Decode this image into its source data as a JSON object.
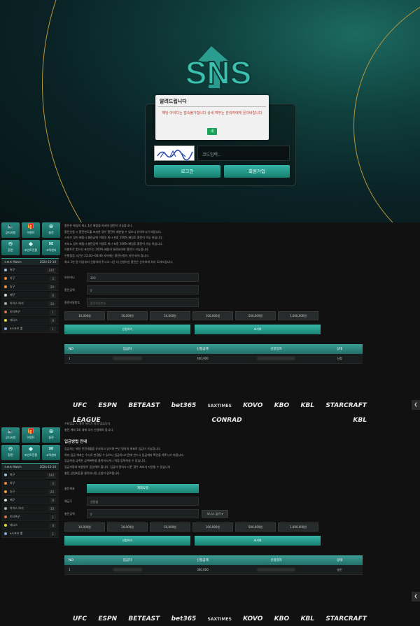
{
  "login": {
    "logo_text": "SNS",
    "modal_title": "알려드립니다",
    "modal_message": "해당 아이디는 접속불가합니다 상세 여부는 관리자에게 문의바랍니다",
    "modal_ok": "네",
    "code_placeholder": "코드입력..",
    "login_button": "로그인",
    "signup_button": "회원가입"
  },
  "sidebar": {
    "tiles": [
      {
        "icon": "speaker-icon",
        "glyph": "🔈",
        "label": "공지사항"
      },
      {
        "icon": "gift-icon",
        "glyph": "🎁",
        "label": "이벤트"
      },
      {
        "icon": "plus-icon",
        "glyph": "⊕",
        "label": "충전"
      },
      {
        "icon": "minus-icon",
        "glyph": "⊖",
        "label": "환전"
      },
      {
        "icon": "diamond-icon",
        "glyph": "◆",
        "label": "포인트전환"
      },
      {
        "icon": "chat-icon",
        "glyph": "✉",
        "label": "고객센터"
      }
    ],
    "header_left": "스포츠 Match",
    "header_right": "2024-10-10",
    "sports": [
      {
        "name": "축구",
        "count": "144",
        "color": "#9bd"
      },
      {
        "name": "야구",
        "count": "3",
        "color": "#e84"
      },
      {
        "name": "농구",
        "count": "20",
        "color": "#e94"
      },
      {
        "name": "배구",
        "count": "8",
        "color": "#ddd"
      },
      {
        "name": "아이스 하키",
        "count": "10",
        "color": "#aaa"
      },
      {
        "name": "미식축구",
        "count": "1",
        "color": "#c74"
      },
      {
        "name": "테니스",
        "count": "8",
        "color": "#dd4"
      },
      {
        "name": "e스포츠 롤",
        "count": "1",
        "color": "#8ad"
      }
    ]
  },
  "withdraw": {
    "notices": [
      "환전은 매일의 최소 1만 배팅을 하셔야 환전이 가능합니다.",
      "환전신청 시 환전한도를 초과한 경우 환전이 제한될 수 있으니 유의하시기 바랍니다.",
      "스포츠 경기 배팅시 충전금액 이용후 게시 포함 100% 배팅후 환전이 가능 하십니다.",
      "카지노 경기 배팅시 충전금액 이용후 게시 포함 100% 배팅후 환전이 가능 하십니다.",
      "이벤트로 받으신 포인트는 200% 배팅이 완료되어야 환전이 가능합니다.",
      "은행점검 시간인 23:30~00:40 사이에는 환전신청이 지연 되어 집니다.",
      "최소 1만 원 이상부터 신청하여 주시고 시간 내 신청하신 환전은 신속하게 처리 도와드립니다."
    ],
    "fields": [
      {
        "label": "보유머니",
        "value": "300"
      },
      {
        "label": "환전금액",
        "value": "0"
      },
      {
        "label": "환전비밀번호",
        "value": "환전비밀번호"
      }
    ],
    "amounts": [
      "10,000원",
      "30,000원",
      "50,000원",
      "100,000원",
      "500,000원",
      "1,000,000원"
    ],
    "apply": "신청하기",
    "reset": "초기화",
    "table_headers": [
      "NO",
      "입금자",
      "신청금액",
      "신청일자",
      "상태"
    ],
    "row": {
      "no": "1",
      "amount": "400,000",
      "status": "신청"
    }
  },
  "partners": [
    "UFC",
    "ESPN",
    "BETEAST",
    "bet365",
    "SAXTIMES",
    "KOVO",
    "KBO",
    "KBL",
    "STARCRAFT"
  ],
  "partners_sub": [
    "LEAGUE",
    "CONRAD",
    "KBL"
  ],
  "deposit": {
    "top_notices": [
      "수표입금 시 충전 처리가 되지 않습니다.",
      "충전 계좌 1회 내에 추가 신청해야 합니다."
    ],
    "title": "입금방법 안내",
    "notices": [
      "입금처는 매일 안전대출을 유지하고 있으며 본인 명의의 계좌로 입금이 가능합니다.",
      "여러 입금 계좌는 수시로 변경될 수 있으니 입금하시기전에 반드시 입금계좌 확인을 해주시기 바랍니다.",
      "입금하실 금액은 금액버튼을 클릭하시거나 직접 입력하실 수 있습니다.",
      "입금자명과 회원명이 동일해야 합니다. 입금자 명의가 다른 경우 처리가 지연될 수 있습니다.",
      "충전 신청버튼을 클릭하시면 신청이 완료됩니다."
    ],
    "account_button": "계좌요청",
    "fields": [
      {
        "label": "충전계좌",
        "value": ""
      },
      {
        "label": "예금주",
        "value": "신동엽"
      },
      {
        "label": "충전금액",
        "value": "0"
      }
    ],
    "bonus_select": "보너스 없이 ▾",
    "amounts": [
      "10,000원",
      "30,000원",
      "50,000원",
      "100,000원",
      "500,000원",
      "1,000,000원"
    ],
    "apply": "신청하기",
    "reset": "초기화",
    "table_headers": [
      "NO",
      "입금자",
      "신청금액",
      "신청일자",
      "상태"
    ],
    "row": {
      "no": "1",
      "amount": "300,000",
      "status": "승인"
    }
  },
  "colors": {
    "accent": "#2a9d90",
    "gold": "#b8963a",
    "background": "#111111"
  }
}
